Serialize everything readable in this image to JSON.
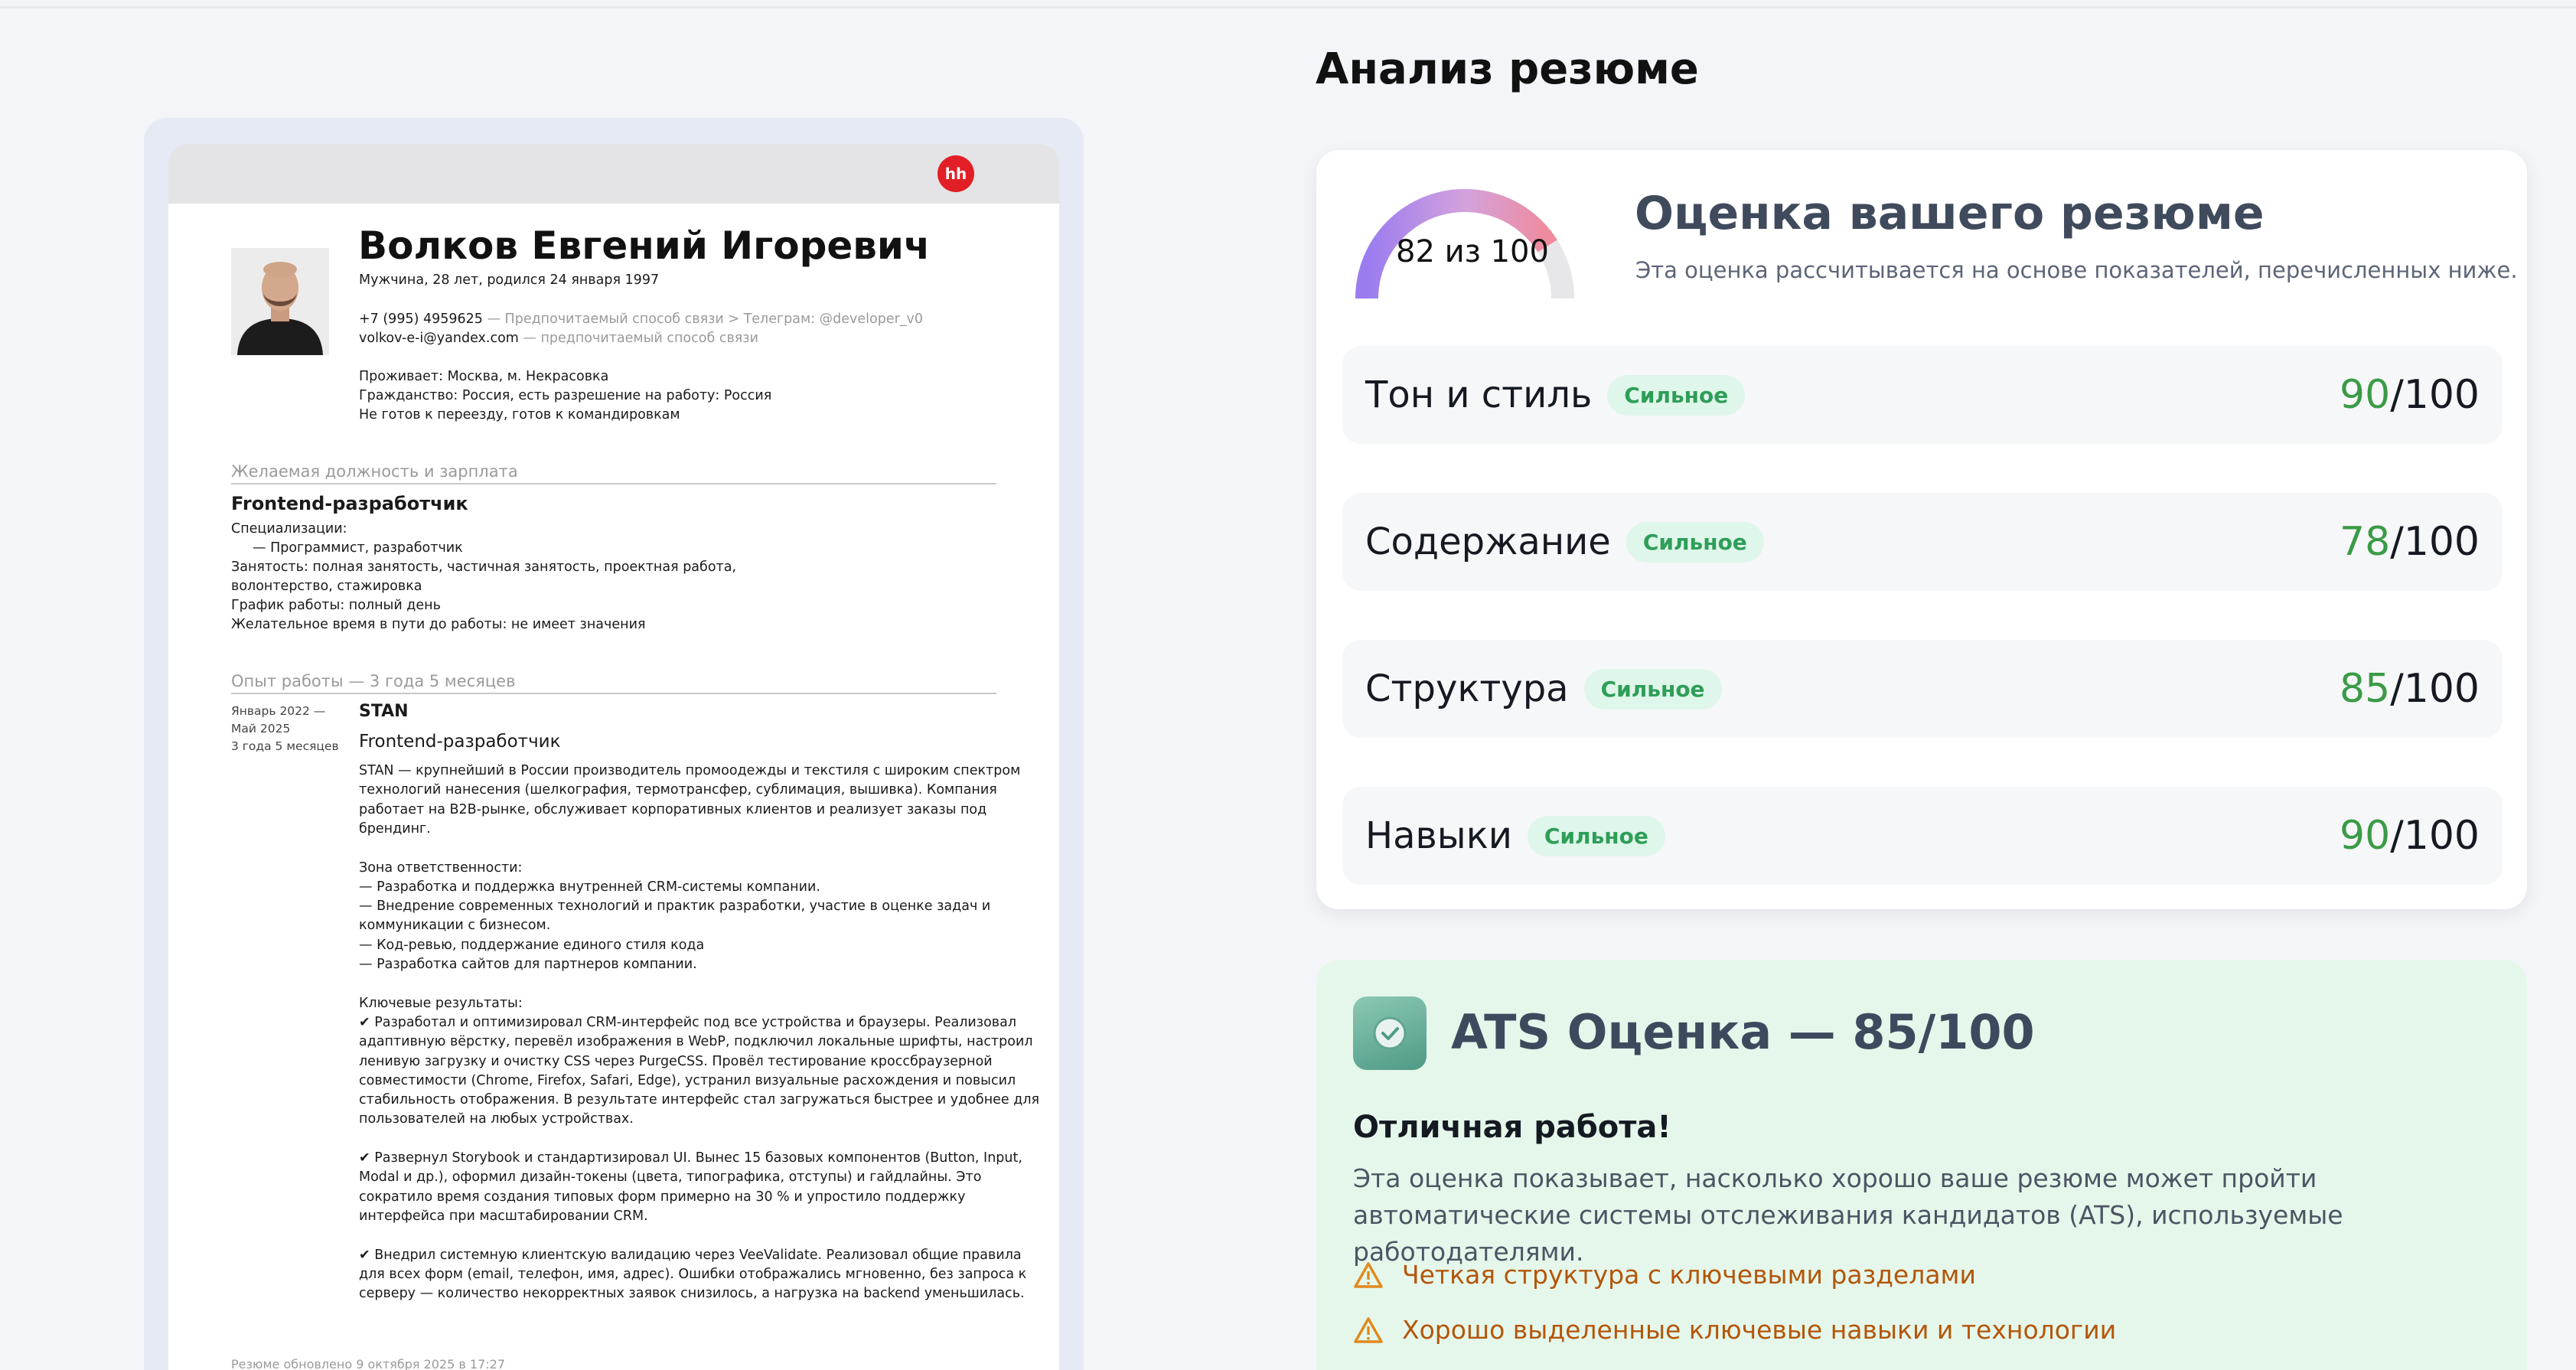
{
  "resume": {
    "brand": "hh",
    "name": "Волков Евгений Игоревич",
    "subtitle": "Мужчина, 28 лет, родился 24 января 1997",
    "phone": "+7 (995) 4959625",
    "phone_note": " — Предпочитаемый способ связи > Телеграм: @developer_v0",
    "email": "volkov-e-i@yandex.com",
    "email_note": " — предпочитаемый способ связи",
    "location": "Проживает: Москва, м. Некрасовка",
    "citizenship": "Гражданство: Россия, есть разрешение на работу: Россия",
    "relocation": "Не готов к переезду, готов к командировкам",
    "section_position": "Желаемая должность и зарплата",
    "position": "Frontend-разработчик",
    "specializations_label": "Специализации:",
    "specialization": "—  Программист, разработчик",
    "employment_1": "Занятость: полная занятость, частичная занятость, проектная работа,",
    "employment_2": "волонтерство, стажировка",
    "schedule": "График работы: полный день",
    "commute": "Желательное время в пути до работы: не имеет значения",
    "section_experience": "Опыт работы — 3 года 5 месяцев",
    "job": {
      "period_1": "Январь 2022 —",
      "period_2": "Май 2025",
      "duration": "3 года 5 месяцев",
      "company": "STAN",
      "title": "Frontend-разработчик",
      "lines": [
        "STAN — крупнейший в России производитель промоодежды и текстиля с широким спектром",
        "технологий нанесения (шелкография, термотрансфер, сублимация, вышивка). Компания",
        "работает на B2B-рынке, обслуживает корпоративных клиентов и реализует заказы под",
        "брендинг.",
        "",
        "Зона ответственности:",
        "— Разработка и поддержка внутренней CRM-системы компании.",
        "— Внедрение современных технологий и практик разработки, участие в оценке задач и",
        "коммуникации с бизнесом.",
        "— Код-ревью, поддержание единого стиля кода",
        "— Разработка сайтов для партнеров компании.",
        "",
        "Ключевые результаты:",
        "✔ Разработал и оптимизировал CRM-интерфейс под все устройства и браузеры. Реализовал",
        "адаптивную вёрстку, перевёл изображения в WebP, подключил локальные шрифты, настроил",
        "ленивую загрузку и очистку CSS через PurgeCSS. Провёл тестирование кроссбраузерной",
        "совместимости (Chrome, Firefox, Safari, Edge), устранил визуальные расхождения и повысил",
        "стабильность отображения. В результате интерфейс стал загружаться быстрее и удобнее для",
        "пользователей на любых устройствах.",
        "",
        "✔ Развернул Storybook и стандартизировал UI. Вынес 15 базовых компонентов (Button, Input,",
        "Modal и др.), оформил дизайн-токены (цвета, типографика, отступы) и гайдлайны. Это",
        "сократило время создания типовых форм примерно на 30 % и упростило поддержку",
        "интерфейса при масштабировании CRM.",
        "",
        "✔ Внедрил системную клиентскую валидацию через VeeValidate. Реализовал общие правила",
        "для всех форм (email, телефон, имя, адрес). Ошибки отображались мгновенно, без запроса к",
        "серверу — количество некорректных заявок снизилось, а нагрузка на backend уменьшилась."
      ]
    },
    "footer": "Резюме обновлено 9 октября 2025 в 17:27"
  },
  "analysis": {
    "title": "Анализ резюме",
    "gauge_label": "82 из 100",
    "gauge_value": 82,
    "gauge_max": 100,
    "score_title": "Оценка вашего резюме",
    "score_subtitle": "Эта оценка рассчитывается на основе показателей, перечисленных ниже.",
    "rows": [
      {
        "label": "Тон и стиль",
        "badge": "Сильное",
        "value": "90",
        "max": "/100"
      },
      {
        "label": "Содержание",
        "badge": "Сильное",
        "value": "78",
        "max": "/100"
      },
      {
        "label": "Структура",
        "badge": "Сильное",
        "value": "85",
        "max": "/100"
      },
      {
        "label": "Навыки",
        "badge": "Сильное",
        "value": "90",
        "max": "/100"
      }
    ]
  },
  "ats": {
    "title": "ATS Оценка — 85/100",
    "heading": "Отличная работа!",
    "text": "Эта оценка показывает, насколько хорошо ваше резюме может пройти автоматические системы отслеживания кандидатов (ATS), используемые работодателями.",
    "items": [
      "Четкая структура с ключевыми разделами",
      "Хорошо выделенные ключевые навыки и технологии"
    ]
  },
  "colors": {
    "accent_green": "#3a9b46",
    "warning": "#b4560a",
    "hh_red": "#e21f26"
  }
}
